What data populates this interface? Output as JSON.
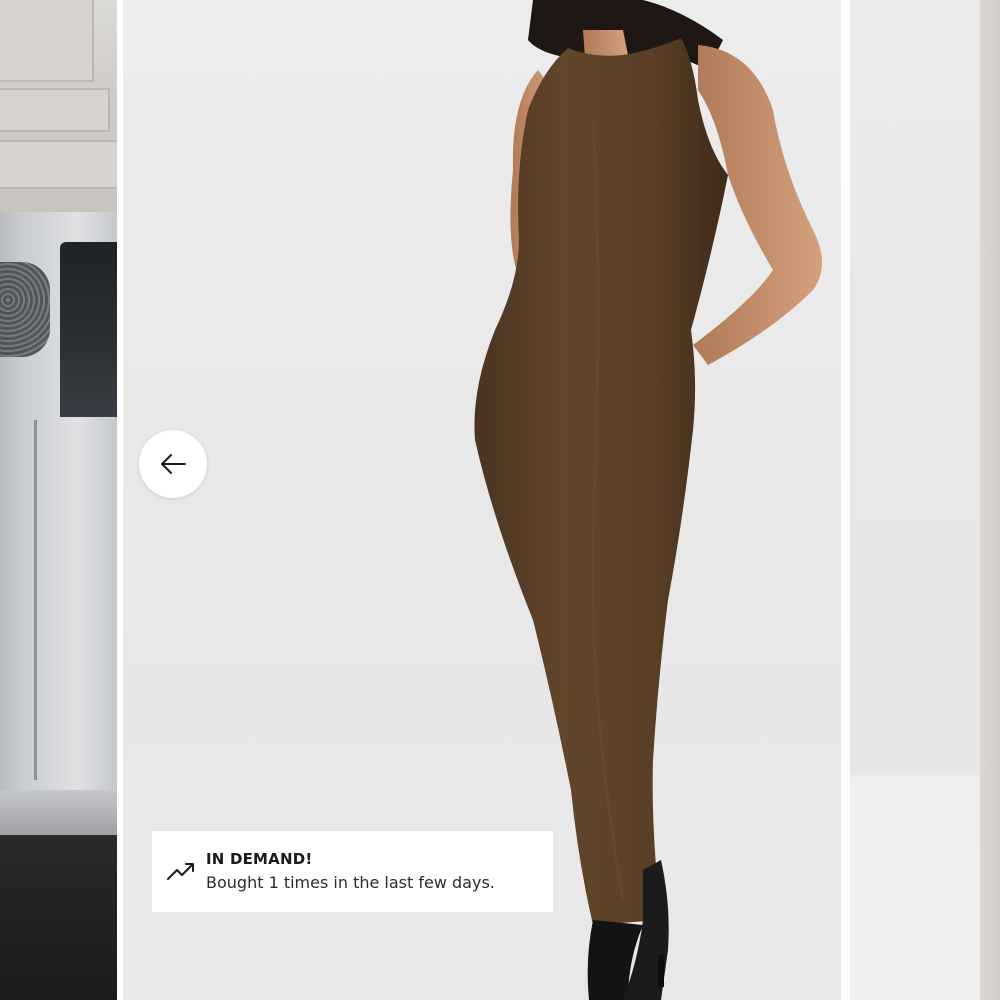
{
  "carousel": {
    "slides": [
      {
        "name": "previous-slide-street-photo"
      },
      {
        "name": "current-slide-product-photo"
      },
      {
        "name": "next-slide-product-photo"
      }
    ],
    "prev_icon": "arrow-left-icon"
  },
  "badge": {
    "icon": "trending-up-icon",
    "title": "IN DEMAND!",
    "subtitle": "Bought 1 times in the last few days."
  },
  "colors": {
    "background": "#ffffff",
    "studio_backdrop": "#e9e9e9",
    "dress": "#5b4128",
    "text_dark": "#1a1a1a"
  }
}
